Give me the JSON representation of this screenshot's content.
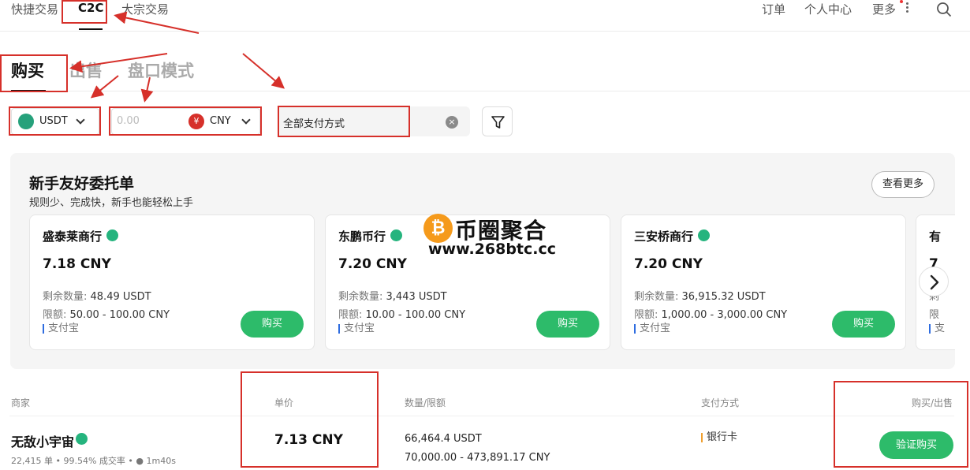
{
  "topnav": {
    "tabs": [
      "快捷交易",
      "C2C",
      "大宗交易"
    ],
    "right": [
      "订单",
      "个人中心",
      "更多"
    ]
  },
  "subtabs": [
    "购买",
    "出售",
    "盘口模式"
  ],
  "filters": {
    "coin": "USDT",
    "amount_placeholder": "0.00",
    "currency_symbol": "¥",
    "currency": "CNY",
    "payment": "全部支付方式",
    "clear_glyph": "×"
  },
  "featured": {
    "title": "新手友好委托单",
    "subtitle": "规则少、完成快，新手也能轻松上手",
    "more": "查看更多",
    "remaining_label": "剩余数量: ",
    "limit_label": "限额: ",
    "cards": [
      {
        "name": "盛泰莱商行",
        "price": "7.18 CNY",
        "remaining": "48.49 USDT",
        "limit": "50.00 - 100.00 CNY",
        "pay": "支付宝",
        "buy": "购买"
      },
      {
        "name": "东鹏币行",
        "price": "7.20 CNY",
        "remaining": "3,443 USDT",
        "limit": "10.00 - 100.00 CNY",
        "pay": "支付宝",
        "buy": "购买"
      },
      {
        "name": "三安桥商行",
        "price": "7.20 CNY",
        "remaining": "36,915.32 USDT",
        "limit": "1,000.00 - 3,000.00 CNY",
        "pay": "支付宝",
        "buy": "购买"
      }
    ],
    "partial_card": {
      "name_glyph": "有",
      "price_glyph": "7",
      "remaining_glyph": "剩",
      "limit_glyph": "限",
      "pay_glyph": "支"
    }
  },
  "watermark": {
    "coin": "₿",
    "text": "币圈聚合",
    "url": "www.268btc.cc"
  },
  "table": {
    "headers": [
      "商家",
      "单价",
      "数量/限额",
      "支付方式",
      "购买/出售"
    ],
    "row": {
      "merchant": "无敌小宇宙",
      "stats": "22,415 单 • 99.54% 成交率 • ● 1m40s",
      "price": "7.13 CNY",
      "quantity": "66,464.4 USDT",
      "limit": "70,000.00 - 473,891.17 CNY",
      "pay": "银行卡",
      "action": "验证购买"
    }
  },
  "colors": {
    "accent_green": "#2dbb6a",
    "annotation_red": "#d6302a",
    "verified": "#25b47e"
  }
}
